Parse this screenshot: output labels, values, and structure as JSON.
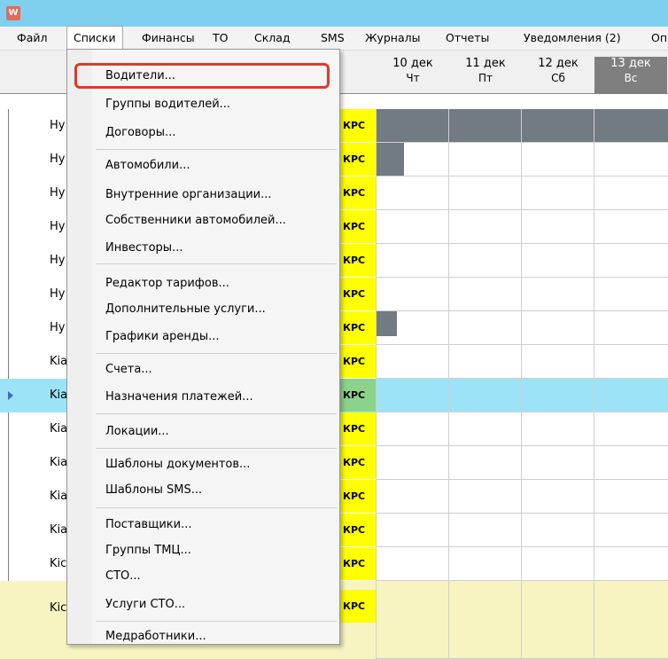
{
  "app": {
    "icon_letter": "W"
  },
  "menubar": {
    "items": [
      {
        "label": "Файл"
      },
      {
        "label": "Списки"
      },
      {
        "label": "Финансы"
      },
      {
        "label": "ТО"
      },
      {
        "label": "Склад"
      },
      {
        "label": "SMS"
      },
      {
        "label": "Журналы"
      },
      {
        "label": "Отчеты"
      },
      {
        "label": "Уведомления (2)"
      },
      {
        "label": "Оп"
      }
    ]
  },
  "schedule": {
    "days": [
      {
        "date": "10 дек",
        "weekday": "Чт"
      },
      {
        "date": "11 дек",
        "weekday": "Пт"
      },
      {
        "date": "12 дек",
        "weekday": "Сб"
      },
      {
        "date": "13 дек",
        "weekday": "Вс"
      }
    ],
    "status_tag": "КРС",
    "rows": [
      {
        "name": "Ну"
      },
      {
        "name": "Ну"
      },
      {
        "name": "Ну"
      },
      {
        "name": "Ну"
      },
      {
        "name": "Ну"
      },
      {
        "name": "Ну"
      },
      {
        "name": "Ну"
      },
      {
        "name": "Kia"
      },
      {
        "name": "Kia"
      },
      {
        "name": "Kia"
      },
      {
        "name": "Kia"
      },
      {
        "name": "Kia"
      },
      {
        "name": "Kia"
      },
      {
        "name": "Kic"
      },
      {
        "name": "Kic"
      }
    ]
  },
  "dropdown": {
    "items": [
      {
        "label": "Водители..."
      },
      {
        "label": "Группы водителей..."
      },
      {
        "label": "Договоры..."
      },
      {
        "label": "Автомобили..."
      },
      {
        "label": "Внутренние организации..."
      },
      {
        "label": "Собственники автомобилей..."
      },
      {
        "label": "Инвесторы..."
      },
      {
        "label": "Редактор тарифов..."
      },
      {
        "label": "Дополнительные услуги..."
      },
      {
        "label": "Графики аренды..."
      },
      {
        "label": "Счета..."
      },
      {
        "label": "Назначения платежей..."
      },
      {
        "label": "Локации..."
      },
      {
        "label": "Шаблоны документов..."
      },
      {
        "label": "Шаблоны SMS..."
      },
      {
        "label": "Поставщики..."
      },
      {
        "label": "Группы ТМЦ..."
      },
      {
        "label": "СТО..."
      },
      {
        "label": "Услуги СТО..."
      },
      {
        "label": "Медработники..."
      }
    ]
  },
  "colors": {
    "titlebar": "#7ed0ee",
    "highlight": "#e03a2a",
    "status_tag": "#ffff00",
    "selected_row": "#9de3f7"
  }
}
